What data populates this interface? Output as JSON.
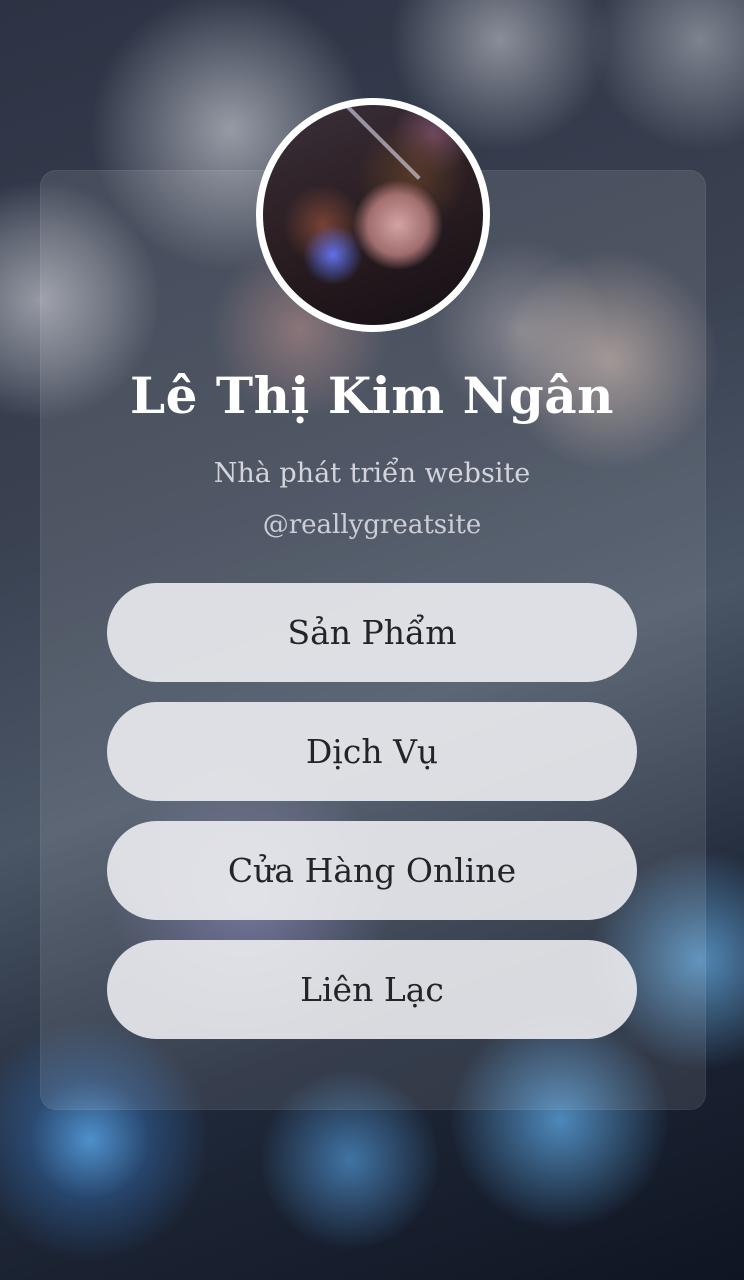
{
  "profile": {
    "name": "Lê Thị Kim Ngân",
    "title": "Nhà phát triển website",
    "handle": "@reallygreatsite"
  },
  "links": [
    {
      "label": "Sản Phẩm"
    },
    {
      "label": "Dịch Vụ"
    },
    {
      "label": "Cửa Hàng Online"
    },
    {
      "label": "Liên Lạc"
    }
  ]
}
